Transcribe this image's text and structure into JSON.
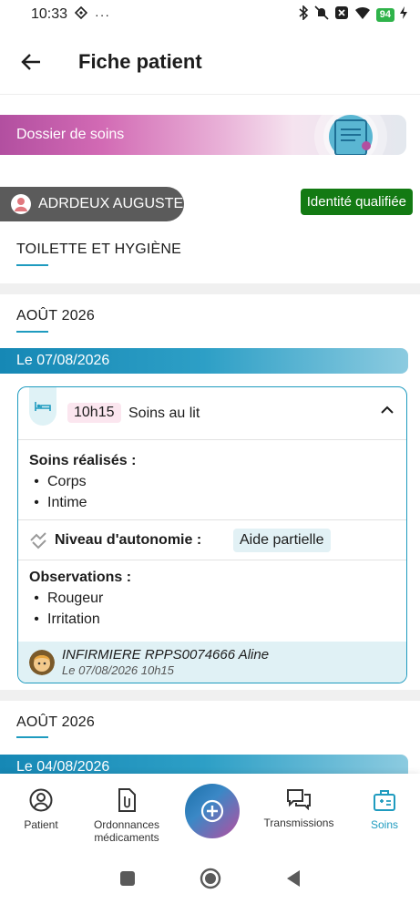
{
  "status_bar": {
    "time": "10:33",
    "battery": "94"
  },
  "header": {
    "title": "Fiche patient"
  },
  "banner": {
    "label": "Dossier de soins"
  },
  "patient": {
    "name": "ADRDEUX AUGUSTE",
    "identity_status": "Identité qualifiée"
  },
  "category": {
    "title": "TOILETTE ET HYGIÈNE"
  },
  "groups": [
    {
      "month": "AOÛT 2026",
      "date_label": "Le 07/08/2026"
    },
    {
      "month": "AOÛT 2026",
      "date_label": "Le 04/08/2026"
    }
  ],
  "care_entry": {
    "time": "10h15",
    "label": "Soins au lit",
    "care_done_title": "Soins réalisés :",
    "care_done_items": [
      "Corps",
      "Intime"
    ],
    "autonomy_label": "Niveau d'autonomie :",
    "autonomy_value": "Aide partielle",
    "observations_title": "Observations :",
    "observations_items": [
      "Rougeur",
      "Irritation"
    ],
    "author": "INFIRMIERE RPPS0074666 Aline",
    "author_date": "Le 07/08/2026 10h15"
  },
  "bottom_nav": {
    "items": [
      {
        "label": "Patient"
      },
      {
        "label_line1": "Ordonnances",
        "label_line2": "médicaments"
      },
      {
        "label": "Transmissions"
      },
      {
        "label": "Soins"
      }
    ]
  },
  "colors": {
    "accent": "#1f9bbf",
    "identity_green": "#137a13",
    "patient_chip": "#5b5b5b"
  }
}
